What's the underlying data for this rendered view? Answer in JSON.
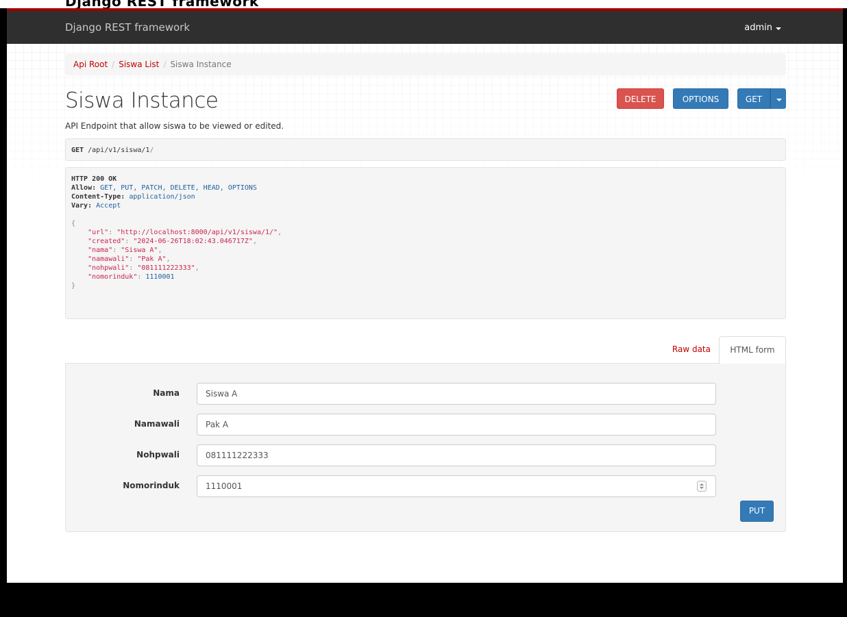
{
  "window_title_clipped": "Django REST framework",
  "navbar": {
    "brand": "Django REST framework",
    "user": "admin"
  },
  "breadcrumb": {
    "items": [
      "Api Root",
      "Siswa List",
      "Siswa Instance"
    ],
    "separator": "/"
  },
  "page": {
    "title": "Siswa Instance",
    "description": "API Endpoint that allow siswa to be viewed or edited."
  },
  "actions": {
    "delete": "DELETE",
    "options": "OPTIONS",
    "get": "GET"
  },
  "request": {
    "method": "GET",
    "path_parts": [
      "/api",
      "/v1",
      "/siswa",
      "/1",
      "/"
    ]
  },
  "response": {
    "status": "HTTP 200 OK",
    "headers": [
      {
        "key": "Allow:",
        "value": "GET, PUT, PATCH, DELETE, HEAD, OPTIONS"
      },
      {
        "key": "Content-Type:",
        "value": "application/json"
      },
      {
        "key": "Vary:",
        "value": "Accept"
      }
    ],
    "open_brace": "{",
    "close_brace": "}",
    "body": [
      {
        "key": "\"url\"",
        "value": "\"http://localhost:8000/api/v1/siswa/1/\"",
        "type": "string"
      },
      {
        "key": "\"created\"",
        "value": "\"2024-06-26T18:02:43.046717Z\"",
        "type": "string"
      },
      {
        "key": "\"nama\"",
        "value": "\"Siswa A\"",
        "type": "string"
      },
      {
        "key": "\"namawali\"",
        "value": "\"Pak A\"",
        "type": "string"
      },
      {
        "key": "\"nohpwali\"",
        "value": "\"081111222333\"",
        "type": "string"
      },
      {
        "key": "\"nomorinduk\"",
        "value": "1110001",
        "type": "number"
      }
    ]
  },
  "tabs": {
    "raw": "Raw data",
    "html": "HTML form"
  },
  "form": {
    "fields": [
      {
        "label": "Nama",
        "value": "Siswa A"
      },
      {
        "label": "Namawali",
        "value": "Pak A"
      },
      {
        "label": "Nohpwali",
        "value": "081111222333"
      },
      {
        "label": "Nomorinduk",
        "value": "1110001"
      }
    ],
    "submit": "PUT"
  },
  "colors": {
    "navbar_bg": "#2f2f2f",
    "navbar_accent": "#a30000",
    "link_red": "#c20000",
    "primary": "#337ab7",
    "danger": "#d9534f"
  }
}
